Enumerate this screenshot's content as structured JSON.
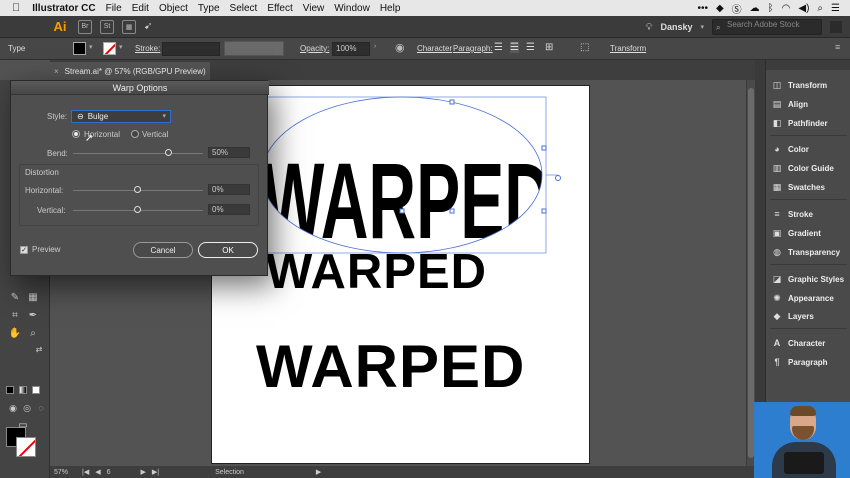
{
  "menubar": {
    "apple": "",
    "app_name": "Illustrator CC",
    "items": [
      "File",
      "Edit",
      "Object",
      "Type",
      "Select",
      "Effect",
      "View",
      "Window",
      "Help"
    ]
  },
  "appbar": {
    "logo": "Ai",
    "btn_br": "Br",
    "btn_st": "St",
    "workspace": "Dansky",
    "search_placeholder": "Search Adobe Stock"
  },
  "controlbar": {
    "selection_type": "Type",
    "stroke_label": "Stroke:",
    "opacity_label": "Opacity:",
    "opacity_value": "100%",
    "character_label": "Character",
    "paragraph_label": "Paragraph:",
    "transform_label": "Transform"
  },
  "document": {
    "tab_title": "Stream.ai* @ 57% (RGB/GPU Preview)",
    "text_lines": [
      "WARPED",
      "WARPED",
      "WARPED"
    ]
  },
  "status": {
    "zoom": "57%",
    "artboard": "6",
    "tool": "Selection"
  },
  "warp_dialog": {
    "title": "Warp Options",
    "style_label": "Style:",
    "style_value": "Bulge",
    "orientation_horizontal": "Horizontal",
    "orientation_vertical": "Vertical",
    "orientation_selected": "Horizontal",
    "bend_label": "Bend:",
    "bend_value": "50%",
    "distortion_label": "Distortion",
    "horizontal_label": "Horizontal:",
    "horizontal_value": "0%",
    "vertical_label": "Vertical:",
    "vertical_value": "0%",
    "preview_label": "Preview",
    "preview_checked": true,
    "cancel_label": "Cancel",
    "ok_label": "OK"
  },
  "dock": {
    "panels": [
      {
        "label": "Transform",
        "icon": "transform-icon"
      },
      {
        "label": "Align",
        "icon": "align-icon"
      },
      {
        "label": "Pathfinder",
        "icon": "pathfinder-icon"
      },
      {
        "label": "Color",
        "icon": "color-icon"
      },
      {
        "label": "Color Guide",
        "icon": "color-guide-icon"
      },
      {
        "label": "Swatches",
        "icon": "swatches-icon"
      },
      {
        "label": "Stroke",
        "icon": "stroke-icon"
      },
      {
        "label": "Gradient",
        "icon": "gradient-icon"
      },
      {
        "label": "Transparency",
        "icon": "transparency-icon"
      },
      {
        "label": "Graphic Styles",
        "icon": "graphic-styles-icon"
      },
      {
        "label": "Appearance",
        "icon": "appearance-icon"
      },
      {
        "label": "Layers",
        "icon": "layers-icon"
      },
      {
        "label": "Character",
        "icon": "character-icon"
      },
      {
        "label": "Paragraph",
        "icon": "paragraph-icon"
      }
    ]
  },
  "colors": {
    "ai_orange": "#ff9a00",
    "selection_blue": "#4a6fd8",
    "dialog_bg": "#4f4f4f"
  }
}
